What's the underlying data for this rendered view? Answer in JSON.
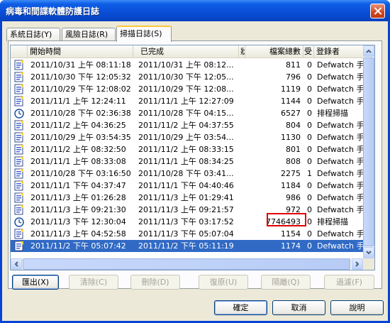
{
  "window": {
    "title": "病毒和間諜軟體防護日誌"
  },
  "tabs": [
    {
      "label": "系統日誌(Y)",
      "active": false
    },
    {
      "label": "風險日誌(R)",
      "active": false
    },
    {
      "label": "掃描日誌(S)",
      "active": true
    }
  ],
  "list": {
    "columns": [
      "",
      "開始時間",
      "已完成",
      "狀",
      "檔案總數",
      "受",
      "登錄者"
    ],
    "rows": [
      {
        "icon": "scan-log-icon",
        "start": "2011/10/31 上午 08:11:18",
        "completed": "2011/10/31 上午 08:12...",
        "status": "",
        "total": "811",
        "affected": "0",
        "by": "Defwatch 手"
      },
      {
        "icon": "scan-log-icon",
        "start": "2011/10/30 下午 12:05:32",
        "completed": "2011/10/30 下午 12:05...",
        "status": "",
        "total": "796",
        "affected": "0",
        "by": "Defwatch 手"
      },
      {
        "icon": "scan-log-icon",
        "start": "2011/10/29 下午 12:08:02",
        "completed": "2011/10/29 下午 12:08...",
        "status": "",
        "total": "1119",
        "affected": "0",
        "by": "Defwatch 手"
      },
      {
        "icon": "scan-log-icon",
        "start": "2011/11/1 上午 12:24:11",
        "completed": "2011/11/1 上午 12:27:09",
        "status": "",
        "total": "1144",
        "affected": "0",
        "by": "Defwatch 手"
      },
      {
        "icon": "scheduled-scan-icon",
        "start": "2011/10/28 下午 02:36:38",
        "completed": "2011/10/28 下午 04:15...",
        "status": "",
        "total": "6527",
        "affected": "0",
        "by": "排程掃描"
      },
      {
        "icon": "scan-log-icon",
        "start": "2011/11/2 上午 04:36:25",
        "completed": "2011/11/2 上午 04:37:55",
        "status": "",
        "total": "804",
        "affected": "0",
        "by": "Defwatch 手"
      },
      {
        "icon": "scan-log-icon",
        "start": "2011/10/29 上午 03:54:35",
        "completed": "2011/10/29 上午 03:54...",
        "status": "",
        "total": "1130",
        "affected": "0",
        "by": "Defwatch 手"
      },
      {
        "icon": "scan-log-icon",
        "start": "2011/11/2 上午 08:32:50",
        "completed": "2011/11/2 上午 08:33:15",
        "status": "",
        "total": "801",
        "affected": "0",
        "by": "Defwatch 手"
      },
      {
        "icon": "scan-log-icon",
        "start": "2011/11/1 上午 08:33:08",
        "completed": "2011/11/1 上午 08:34:25",
        "status": "",
        "total": "808",
        "affected": "0",
        "by": "Defwatch 手"
      },
      {
        "icon": "scan-log-icon",
        "start": "2011/10/28 下午 03:16:50",
        "completed": "2011/10/28 下午 03:41...",
        "status": "",
        "total": "2275",
        "affected": "1",
        "by": "Defwatch 手"
      },
      {
        "icon": "scan-log-icon",
        "start": "2011/11/1 下午 04:37:47",
        "completed": "2011/11/1 下午 04:40:46",
        "status": "",
        "total": "1184",
        "affected": "0",
        "by": "Defwatch 手"
      },
      {
        "icon": "scan-log-icon",
        "start": "2011/11/3 上午 01:26:28",
        "completed": "2011/11/3 上午 01:29:41",
        "status": "",
        "total": "986",
        "affected": "0",
        "by": "Defwatch 手"
      },
      {
        "icon": "scan-log-icon",
        "start": "2011/11/3 上午 09:21:30",
        "completed": "2011/11/3 上午 09:21:57",
        "status": "",
        "total": "972",
        "affected": "0",
        "by": "Defwatch 手"
      },
      {
        "icon": "scheduled-scan-icon",
        "start": "2011/11/3 下午 12:30:04",
        "completed": "2011/11/3 下午 03:17:52",
        "status": "",
        "total": "7746493",
        "affected": "0",
        "by": "排程掃描"
      },
      {
        "icon": "scan-log-icon",
        "start": "2011/11/3 上午 04:52:58",
        "completed": "2011/11/3 下午 05:07:04",
        "status": "",
        "total": "1154",
        "affected": "0",
        "by": "Defwatch 手"
      },
      {
        "icon": "scan-log-icon",
        "start": "2011/11/2 下午 05:07:42",
        "completed": "2011/11/2 下午 05:11:19",
        "status": "",
        "total": "1174",
        "affected": "0",
        "by": "Defwatch 手"
      }
    ],
    "selected_row": 15,
    "highlighted_value": "7746493"
  },
  "actions": {
    "export": "匯出(X)",
    "clear": "清除(C)",
    "delete": "刪除(D)",
    "restore": "復原(U)",
    "quarantine": "隔離(Q)",
    "filter": "過濾(F)"
  },
  "dialog_buttons": {
    "ok": "確定",
    "cancel": "取消",
    "help": "說明"
  },
  "colors": {
    "title_bar": "#0a4fd8",
    "selection": "#316ac5",
    "highlight_box": "#e00000"
  }
}
